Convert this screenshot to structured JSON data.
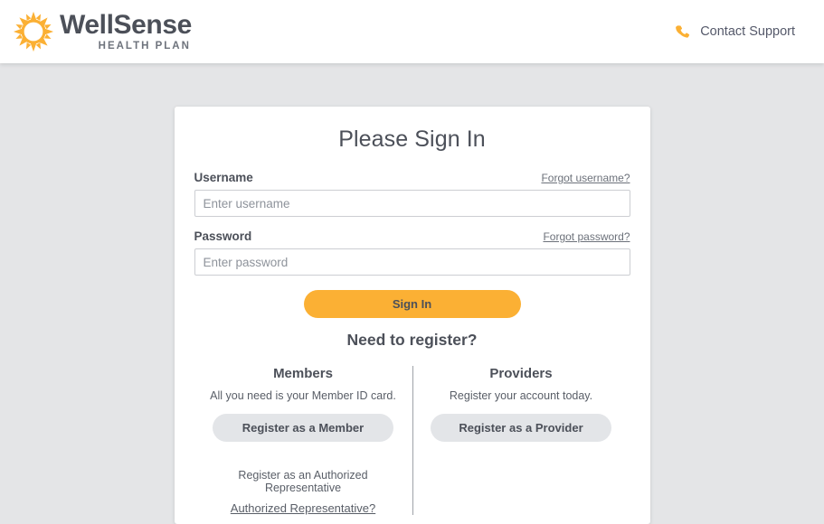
{
  "header": {
    "brand": {
      "logo_icon": "sun-icon",
      "name": "WellSense",
      "tagline": "HEALTH PLAN"
    },
    "support": {
      "icon": "phone-icon",
      "label": "Contact Support"
    }
  },
  "card": {
    "title": "Please Sign In",
    "username": {
      "label": "Username",
      "forgot_link": "Forgot username?",
      "placeholder": "Enter username",
      "value": ""
    },
    "password": {
      "label": "Password",
      "forgot_link": "Forgot password?",
      "placeholder": "Enter password",
      "value": ""
    },
    "signin_button": "Sign In",
    "register": {
      "title": "Need to register?",
      "members": {
        "heading": "Members",
        "subtitle": "All you need is your Member ID card.",
        "button": "Register as a Member",
        "auth_rep_text": "Register as an Authorized Representative",
        "auth_rep_link": "Authorized Representative?"
      },
      "providers": {
        "heading": "Providers",
        "subtitle": "Register your account today.",
        "button": "Register as a Provider"
      }
    }
  },
  "colors": {
    "accent": "#fbb034",
    "text": "#4c5059",
    "page_background": "#e4e5e7",
    "button_secondary": "#e3e5e8"
  }
}
